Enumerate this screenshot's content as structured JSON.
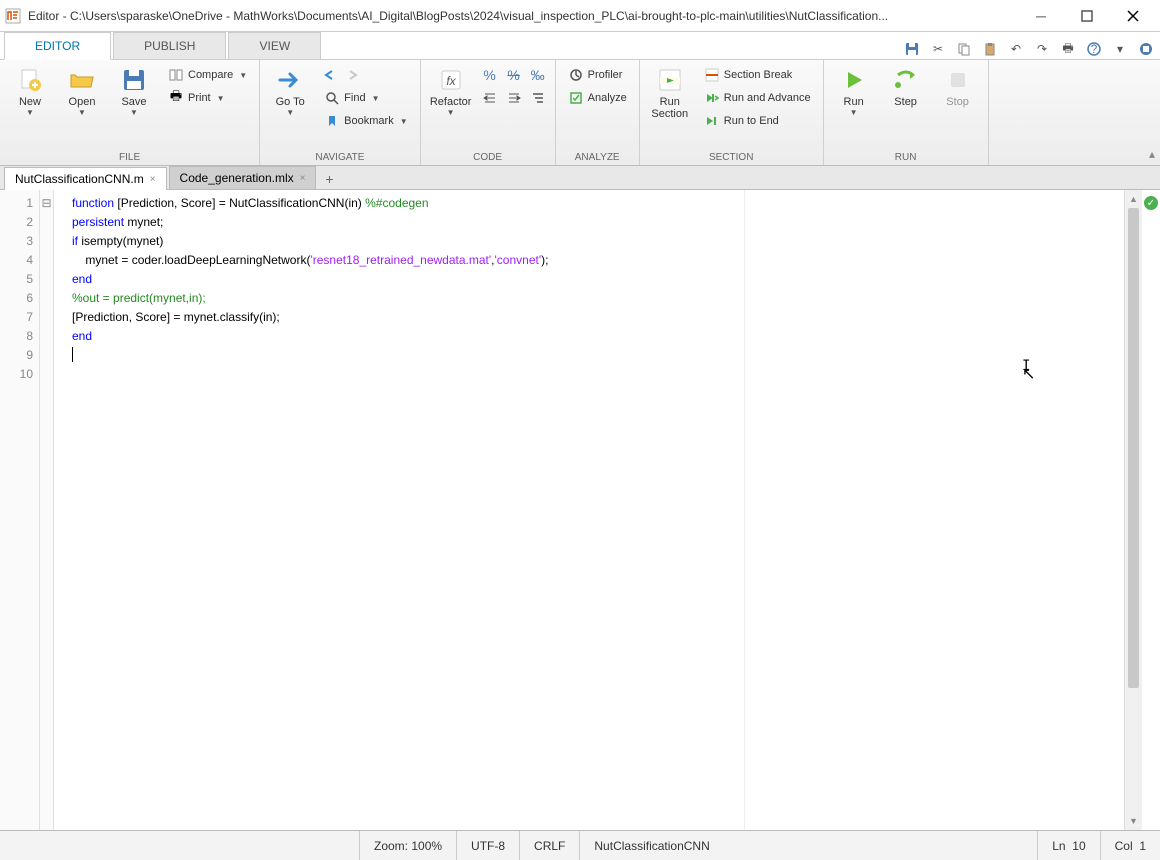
{
  "window": {
    "title": "Editor - C:\\Users\\sparaske\\OneDrive - MathWorks\\Documents\\AI_Digital\\BlogPosts\\2024\\visual_inspection_PLC\\ai-brought-to-plc-main\\utilities\\NutClassification..."
  },
  "toptabs": {
    "editor": "EDITOR",
    "publish": "PUBLISH",
    "view": "VIEW"
  },
  "toolstrip": {
    "file": {
      "new": "New",
      "open": "Open",
      "save": "Save",
      "compare": "Compare",
      "print": "Print",
      "label": "FILE"
    },
    "navigate": {
      "goto": "Go To",
      "find": "Find",
      "bookmark": "Bookmark",
      "label": "NAVIGATE"
    },
    "code": {
      "refactor": "Refactor",
      "label": "CODE"
    },
    "analyze": {
      "profiler": "Profiler",
      "analyze": "Analyze",
      "label": "ANALYZE"
    },
    "section": {
      "runsection": "Run\nSection",
      "sectionbreak": "Section Break",
      "runadvance": "Run and Advance",
      "runtoend": "Run to End",
      "label": "SECTION"
    },
    "run": {
      "run": "Run",
      "step": "Step",
      "stop": "Stop",
      "label": "RUN"
    }
  },
  "filetabs": {
    "tab1": "NutClassificationCNN.m",
    "tab2": "Code_generation.mlx"
  },
  "code": {
    "l1a": "function",
    "l1b": " [Prediction, Score] = NutClassificationCNN(in) ",
    "l1c": "%#codegen",
    "l2": "",
    "l3a": "persistent",
    "l3b": " mynet;",
    "l4a": "if",
    "l4b": " isempty(mynet)",
    "l5a": "    mynet = coder.loadDeepLearningNetwork(",
    "l5b": "'resnet18_retrained_newdata.mat'",
    "l5c": ",",
    "l5d": "'convnet'",
    "l5e": ");",
    "l6": "end",
    "l7a": "%out = predict(mynet,in);",
    "l8": "[Prediction, Score] = mynet.classify(in);",
    "l9": "end",
    "l10": ""
  },
  "lines": {
    "n1": "1",
    "n2": "2",
    "n3": "3",
    "n4": "4",
    "n5": "5",
    "n6": "6",
    "n7": "7",
    "n8": "8",
    "n9": "9",
    "n10": "10"
  },
  "status": {
    "zoom": "Zoom: 100%",
    "encoding": "UTF-8",
    "eol": "CRLF",
    "func": "NutClassificationCNN",
    "ln_label": "Ln",
    "ln_val": "10",
    "col_label": "Col",
    "col_val": "1"
  }
}
